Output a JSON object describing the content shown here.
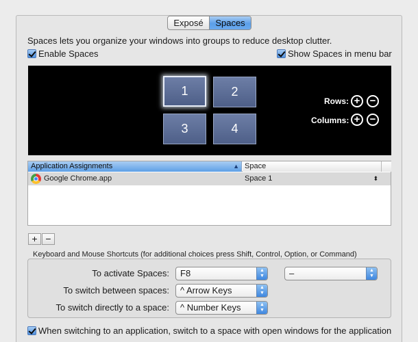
{
  "segmented": {
    "tabs": [
      {
        "label": "Exposé"
      },
      {
        "label": "Spaces"
      }
    ],
    "selected": "Spaces"
  },
  "description": "Spaces lets you organize your windows into groups to reduce desktop clutter.",
  "enable_spaces": {
    "label": "Enable Spaces",
    "checked": true
  },
  "show_in_menu_bar": {
    "label": "Show Spaces in menu bar",
    "checked": true
  },
  "spaces_preview": {
    "spaces": [
      "1",
      "2",
      "3",
      "4"
    ],
    "active_space": "1",
    "rows_label": "Rows:",
    "columns_label": "Columns:",
    "add_symbol": "+",
    "remove_symbol": "−"
  },
  "assignments_table": {
    "columns": [
      "Application Assignments",
      "Space"
    ],
    "sort_indicator": "▲",
    "rows": [
      {
        "app": "Google Chrome.app",
        "space": "Space 1",
        "icon": "chrome-icon"
      }
    ],
    "stepper": "⬍"
  },
  "list_buttons": {
    "add": "+",
    "remove": "−"
  },
  "shortcuts": {
    "title": "Keyboard and Mouse Shortcuts (for additional choices press Shift, Control, Option, or Command)",
    "activate_label": "To activate Spaces:",
    "activate_key": "F8",
    "activate_mouse": "–",
    "switch_between_label": "To switch between spaces:",
    "switch_between_value": "^ Arrow Keys",
    "switch_directly_label": "To switch directly to a space:",
    "switch_directly_value": "^ Number Keys"
  },
  "switch_option": {
    "label": "When switching to an application, switch to a space with open windows for the application",
    "checked": true
  },
  "colors": {
    "accent": "#5b9ee8",
    "preview_bg": "#000000",
    "space_tile": "#5a6b93"
  }
}
